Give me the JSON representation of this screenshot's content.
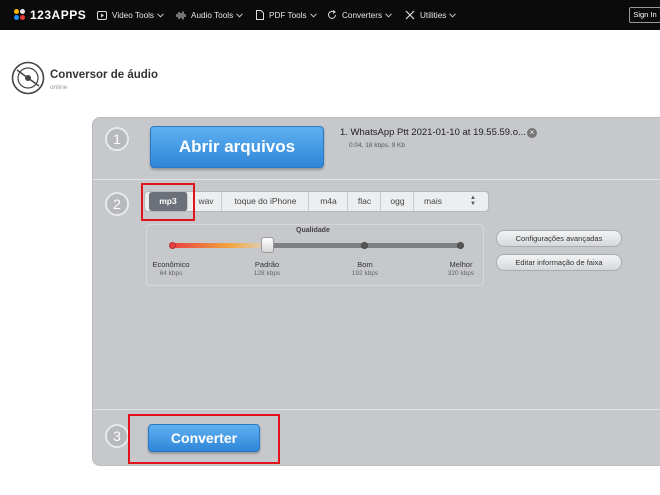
{
  "brand": {
    "name": "123APPS"
  },
  "nav": {
    "items": [
      {
        "label": "Video Tools",
        "icon": "play-icon"
      },
      {
        "label": "Audio Tools",
        "icon": "waveform-icon"
      },
      {
        "label": "PDF Tools",
        "icon": "document-icon"
      },
      {
        "label": "Converters",
        "icon": "refresh-icon"
      },
      {
        "label": "Utilities",
        "icon": "tools-icon"
      }
    ],
    "signin": "Sign In"
  },
  "page": {
    "title": "Conversor de áudio",
    "subtitle": "online"
  },
  "steps": [
    "1",
    "2",
    "3"
  ],
  "open_button": "Abrir arquivos",
  "file": {
    "name": "1. WhatsApp Ptt 2021-01-10 at 19.55.59.o...",
    "meta": "0:04, 18 kbps, 9 Kb"
  },
  "formats": {
    "items": [
      "mp3",
      "wav",
      "toque do iPhone",
      "m4a",
      "flac",
      "ogg",
      "mais"
    ],
    "selected": "mp3"
  },
  "quality": {
    "label": "Qualidade",
    "selected": "Padrão",
    "levels": [
      {
        "name": "Econômico",
        "rate": "64 kbps"
      },
      {
        "name": "Padrão",
        "rate": "128 kbps"
      },
      {
        "name": "Bom",
        "rate": "192 kbps"
      },
      {
        "name": "Melhor",
        "rate": "320 kbps"
      }
    ]
  },
  "advanced_button": "Configurações avançadas",
  "track_info_button": "Editar informação de faixa",
  "convert_button": "Converter",
  "colors": {
    "accent": "#3a92e0",
    "highlight": "#e1131b",
    "topbar": "#0b0b0b"
  }
}
